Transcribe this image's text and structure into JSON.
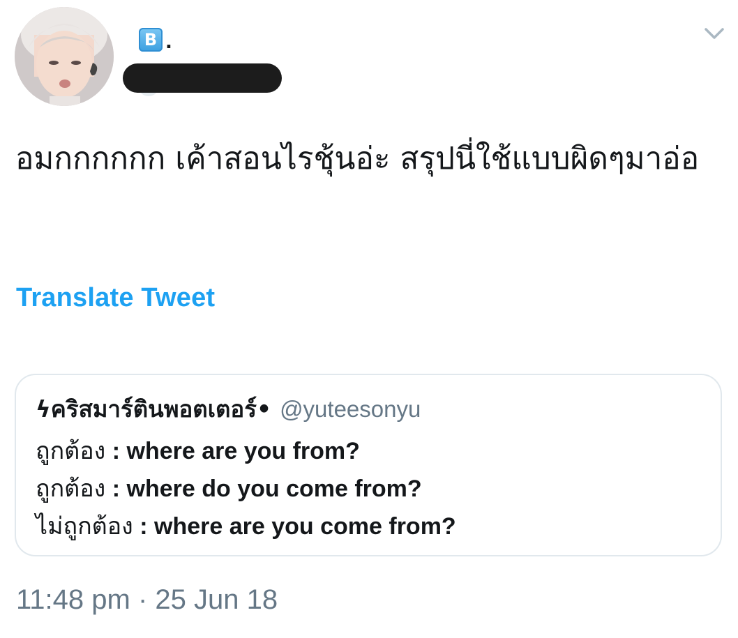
{
  "tweet": {
    "author": {
      "badge_letter": "B",
      "name_suffix": ".",
      "avatar_icon": "profile-photo"
    },
    "menu_icon": "chevron-down-icon",
    "text": "อมกกกกกก เค้าสอนไรชุ้นอ่ะ สรุปนี่ใช้แบบผิดๆมาอ่อ",
    "translate_label": "Translate Tweet",
    "quoted": {
      "author_name": "ϟคริสมาร์ตินพอตเตอร์•",
      "author_handle": "@yuteesonyu",
      "lines": [
        {
          "label": "ถูกต้อง",
          "sep": " : ",
          "value": "where are you from?"
        },
        {
          "label": "ถูกต้อง",
          "sep": " : ",
          "value": "where do you come from?"
        },
        {
          "label": "ไม่ถูกต้อง",
          "sep": " : ",
          "value": "where are you come from?"
        }
      ]
    },
    "time": "11:48 pm",
    "date_separator": "·",
    "date": "25 Jun 18"
  },
  "colors": {
    "link": "#1da1f2",
    "secondary_text": "#657786",
    "primary_text": "#14171a",
    "border": "#e1e8ed",
    "badge": "#3b9fe0"
  }
}
